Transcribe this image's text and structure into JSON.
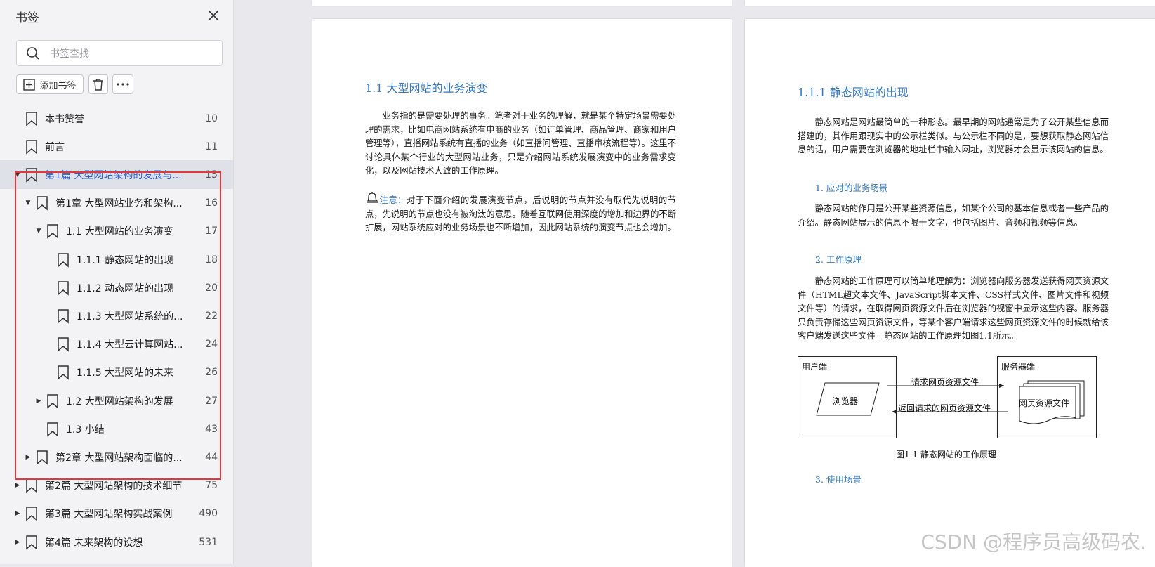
{
  "sidebar": {
    "title": "书签",
    "search_placeholder": "书签查找",
    "add_bookmark_label": "添加书签",
    "items": [
      {
        "label": "本书赞誉",
        "page": "10"
      },
      {
        "label": "前言",
        "page": "11"
      },
      {
        "label": "第1篇 大型网站架构的发展与...",
        "page": "15"
      },
      {
        "label": "第1章 大型网站业务和架构...",
        "page": "16"
      },
      {
        "label": "1.1 大型网站的业务演变",
        "page": "17"
      },
      {
        "label": "1.1.1 静态网站的出现",
        "page": "18"
      },
      {
        "label": "1.1.2 动态网站的出现",
        "page": "20"
      },
      {
        "label": "1.1.3 大型网站系统的...",
        "page": "22"
      },
      {
        "label": "1.1.4 大型云计算网站...",
        "page": "24"
      },
      {
        "label": "1.1.5 大型网站的未来",
        "page": "26"
      },
      {
        "label": "1.2 大型网站架构的发展",
        "page": "27"
      },
      {
        "label": "1.3 小结",
        "page": "43"
      },
      {
        "label": "第2章 大型网站架构面临的...",
        "page": "44"
      },
      {
        "label": "第2篇 大型网站架构的技术细节",
        "page": "75"
      },
      {
        "label": "第3篇 大型网站架构实战案例",
        "page": "490"
      },
      {
        "label": "第4篇 未来架构的设想",
        "page": "531"
      }
    ]
  },
  "pageA": {
    "heading": "1.1   大型网站的业务演变",
    "para1": "业务指的是需要处理的事务。笔者对于业务的理解，就是某个特定场景需要处理的需求，比如电商网站系统有电商的业务（如订单管理、商品管理、商家和用户管理等），直播网站系统有直播的业务（如直播间管理、直播审核流程等）。这里不讨论具体某个行业的大型网站业务，只是介绍网站系统发展演变中的业务需求变化，以及网站技术大致的工作原理。",
    "note_label": "注意：",
    "note_text": "对于下面介绍的发展演变节点，后说明的节点并没有取代先说明的节点，先说明的节点也没有被淘汰的意思。随着互联网使用深度的增加和边界的不断扩展，网站系统应对的业务场景也不断增加，因此网站系统的演变节点也会增加。"
  },
  "pageB": {
    "heading": "1.1.1   静态网站的出现",
    "para1": "静态网站是网站最简单的一种形态。最早期的网站通常是为了公开某些信息而搭建的，其作用跟现实中的公示栏类似。与公示栏不同的是，要想获取静态网站信息的话，用户需要在浏览器的地址栏中输入网址，浏览器才会显示该网站的信息。",
    "sub1": "1. 应对的业务场景",
    "para2": "静态网站的作用是公开某些资源信息，如某个公司的基本信息或者一些产品的介绍。静态网站展示的信息不限于文字，也包括图片、音频和视频等信息。",
    "sub2": "2. 工作原理",
    "para3": "静态网站的工作原理可以简单地理解为：浏览器向服务器发送获得网页资源文件（HTML超文本文件、JavaScript脚本文件、CSS样式文件、图片文件和视频文件等）的请求，在取得网页资源文件后在浏览器的视窗中显示这些内容。服务器只负责存储这些网页资源文件，等某个客户端请求这些网页资源文件的时候就给该客户端发送这些文件。静态网站的工作原理如图1.1所示。",
    "diagram": {
      "client_title": "用户端",
      "server_title": "服务器端",
      "browser": "浏览器",
      "resource": "网页资源文件",
      "request": "请求网页资源文件",
      "response": "返回请求的网页资源文件"
    },
    "caption": "图1.1   静态网站的工作原理",
    "sub3": "3. 使用场景"
  },
  "watermark": "CSDN @程序员高级码农."
}
